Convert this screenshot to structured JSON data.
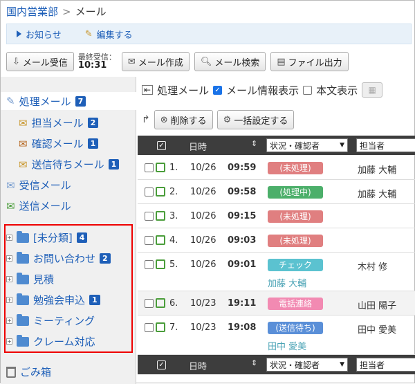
{
  "breadcrumb": {
    "app": "国内営業部",
    "separator": ">",
    "current": "メール"
  },
  "notice": {
    "news_label": "お知らせ",
    "edit_label": "編集する"
  },
  "toolbar": {
    "receive_label": "メール受信",
    "last_received_label": "最終受信：",
    "last_received_time": "10:31",
    "compose_label": "メール作成",
    "search_label": "メール検索",
    "export_label": "ファイル出力"
  },
  "sidebar": {
    "processing": {
      "label": "処理メール",
      "count": "7"
    },
    "assigned": {
      "label": "担当メール",
      "count": "2"
    },
    "confirm": {
      "label": "確認メール",
      "count": "1"
    },
    "pending": {
      "label": "送信待ちメール",
      "count": "1"
    },
    "inbox": {
      "label": "受信メール"
    },
    "sent": {
      "label": "送信メール"
    },
    "folders": [
      {
        "label": "[未分類]",
        "count": "4"
      },
      {
        "label": "お問い合わせ",
        "count": "2"
      },
      {
        "label": "見積",
        "count": ""
      },
      {
        "label": "勉強会申込",
        "count": "1"
      },
      {
        "label": "ミーティング",
        "count": ""
      },
      {
        "label": "クレーム対応",
        "count": ""
      }
    ],
    "trash": {
      "label": "ごみ箱"
    }
  },
  "main": {
    "view_title": "処理メール",
    "show_info_label": "メール情報表示",
    "show_body_label": "本文表示",
    "delete_label": "削除する",
    "bulk_label": "一括設定する",
    "columns": {
      "date": "日時",
      "status": "状況・確認者",
      "assignee": "担当者"
    },
    "rows": [
      {
        "num": "1.",
        "date": "10/26",
        "time": "09:59",
        "status": "(未処理)",
        "status_color": "#e07f80",
        "assignee": "加藤 大輔",
        "confirmer": ""
      },
      {
        "num": "2.",
        "date": "10/26",
        "time": "09:58",
        "status": "(処理中)",
        "status_color": "#4caf6a",
        "assignee": "加藤 大輔",
        "confirmer": ""
      },
      {
        "num": "3.",
        "date": "10/26",
        "time": "09:15",
        "status": "(未処理)",
        "status_color": "#e07f80",
        "assignee": "",
        "confirmer": ""
      },
      {
        "num": "4.",
        "date": "10/26",
        "time": "09:03",
        "status": "(未処理)",
        "status_color": "#e07f80",
        "assignee": "",
        "confirmer": ""
      },
      {
        "num": "5.",
        "date": "10/26",
        "time": "09:01",
        "status": "チェック",
        "status_color": "#5bc2d0",
        "assignee": "木村 修",
        "confirmer": "加藤 大輔"
      },
      {
        "num": "6.",
        "date": "10/23",
        "time": "19:11",
        "status": "電話連絡",
        "status_color": "#f28ab2",
        "assignee": "山田 陽子",
        "confirmer": ""
      },
      {
        "num": "7.",
        "date": "10/23",
        "time": "19:08",
        "status": "(送信待ち)",
        "status_color": "#5a8fd8",
        "assignee": "田中 愛美",
        "confirmer": "田中 愛美"
      }
    ]
  }
}
